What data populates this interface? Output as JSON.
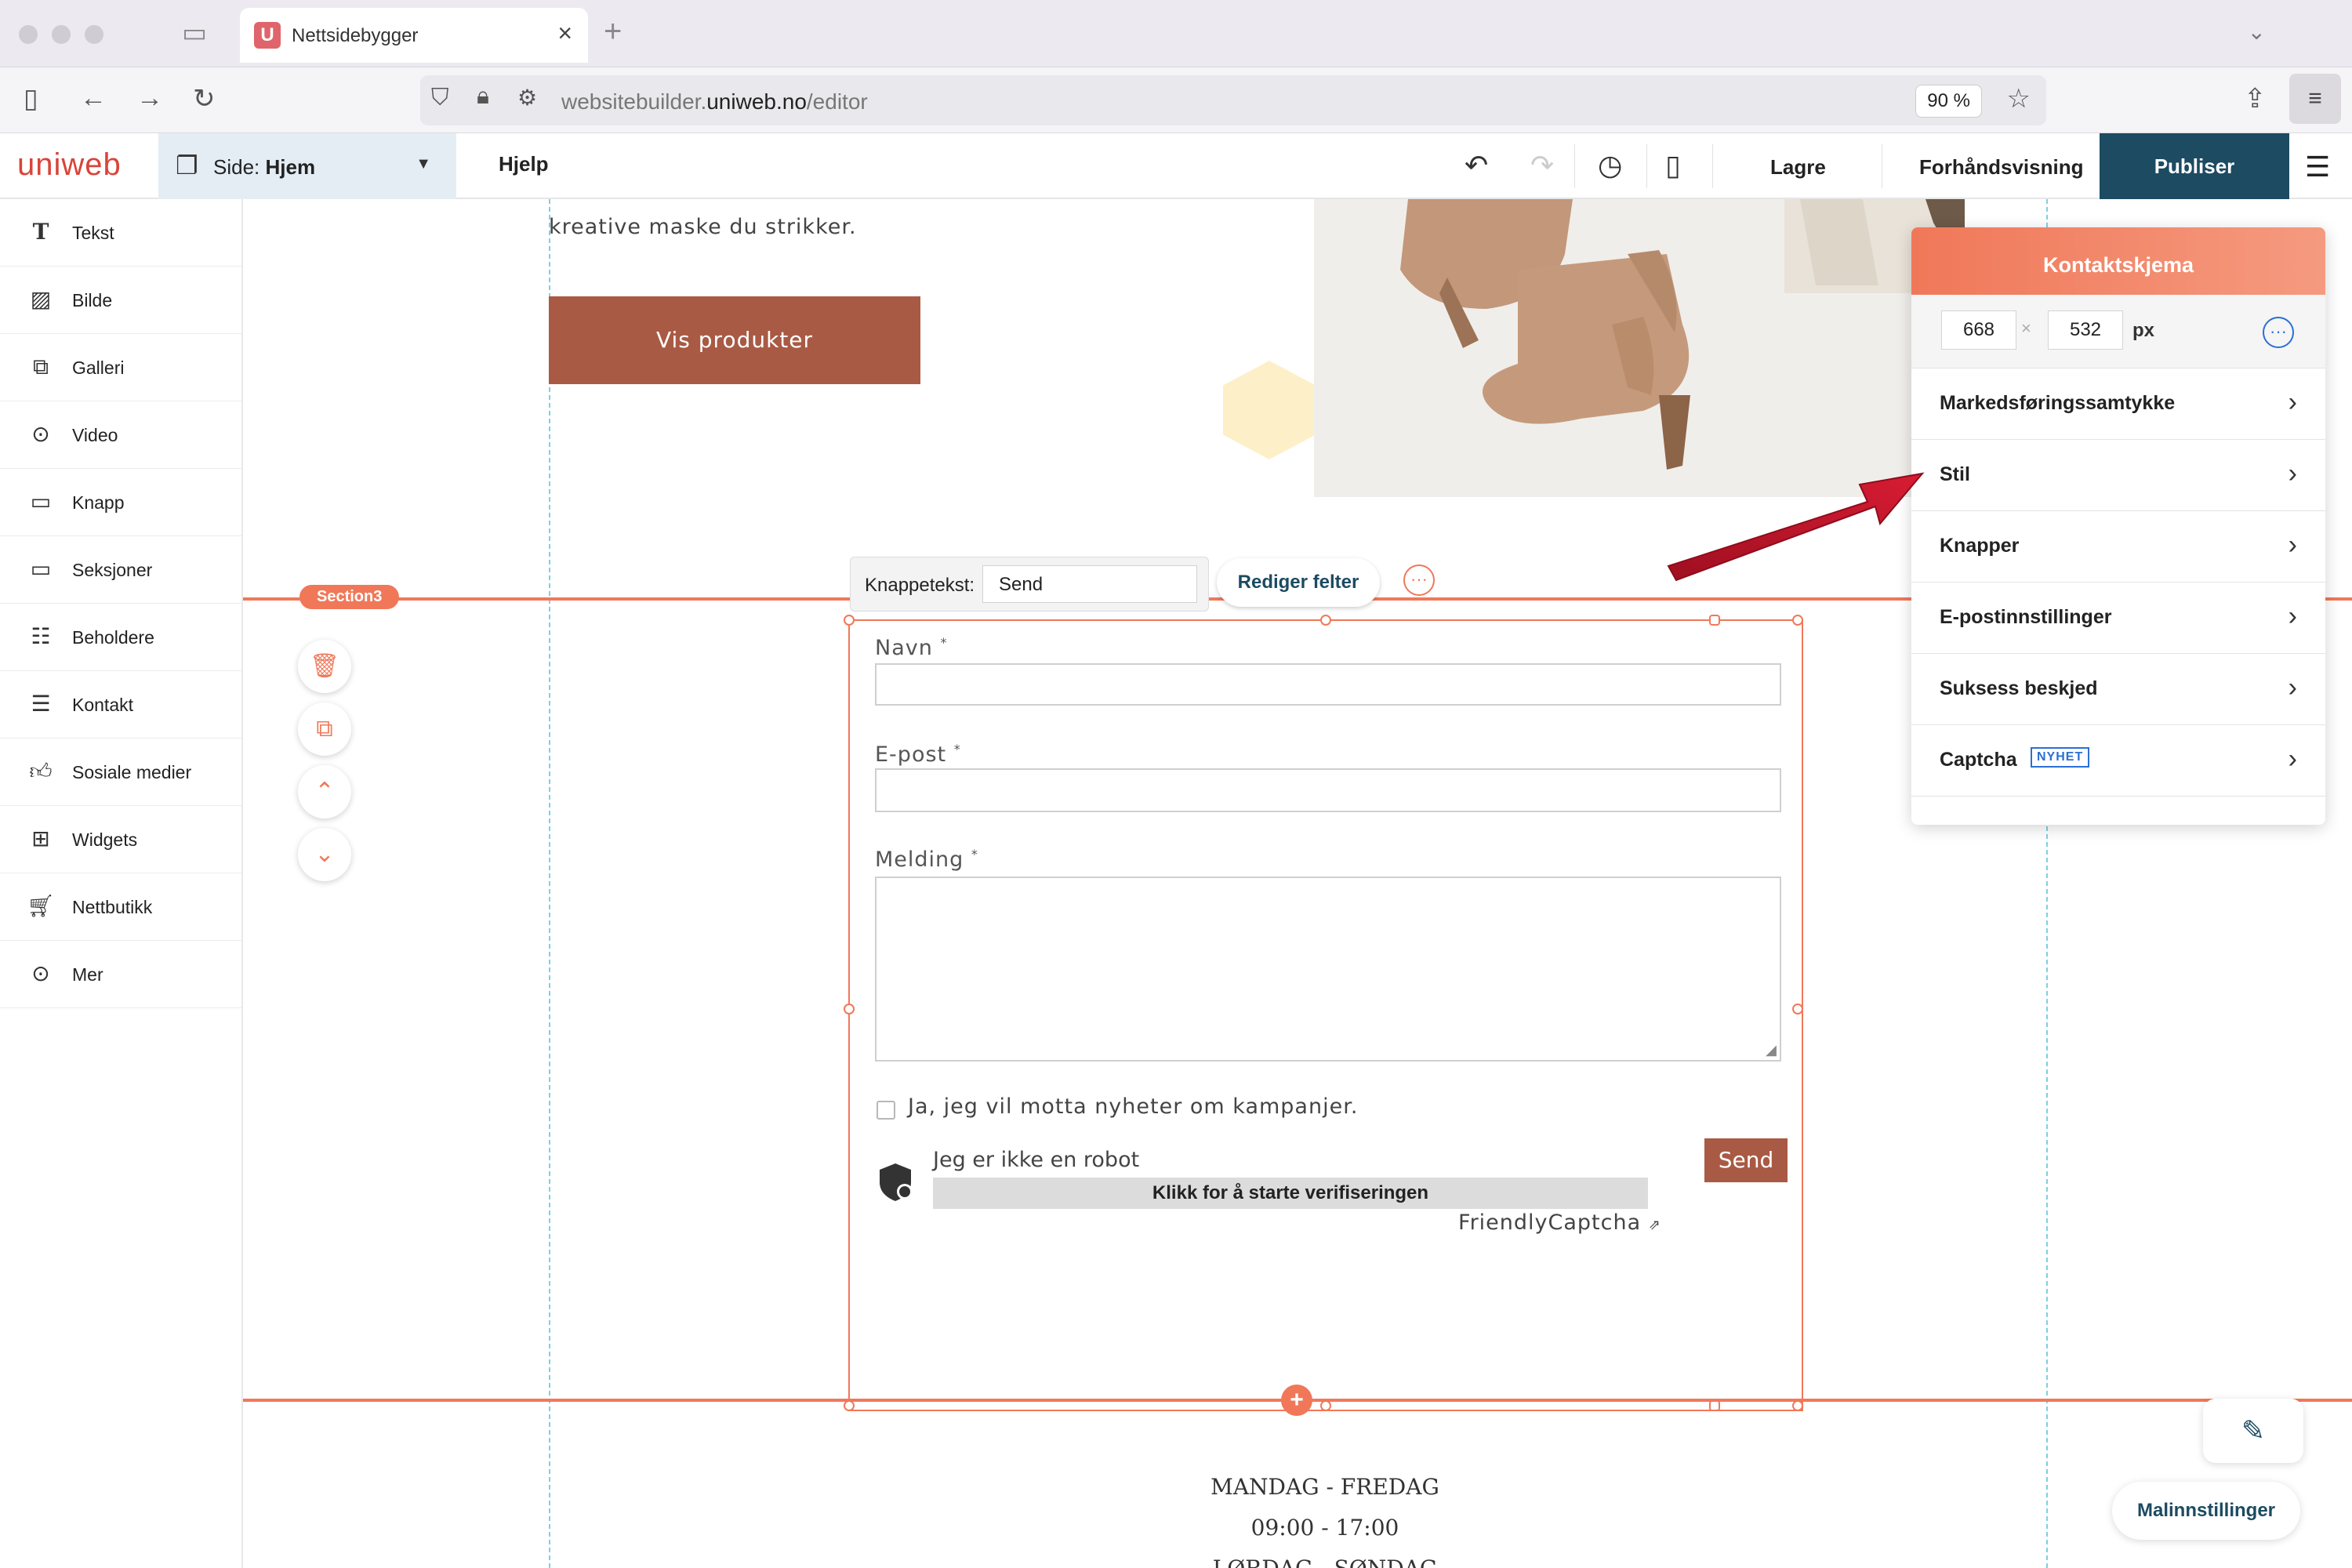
{
  "browser": {
    "tab_title": "Nettsidebygger",
    "tab_favicon": "U",
    "url_host": "websitebuilder.",
    "url_domain": "uniweb.no",
    "url_path": "/editor",
    "zoom": "90 %"
  },
  "app": {
    "logo": "uniweb",
    "page_label": "Side:",
    "page_name": "Hjem",
    "help": "Hjelp",
    "save": "Lagre",
    "preview": "Forhåndsvisning",
    "publish": "Publiser"
  },
  "sidebar": {
    "items": [
      {
        "label": "Tekst",
        "icon": "text-icon"
      },
      {
        "label": "Bilde",
        "icon": "image-icon"
      },
      {
        "label": "Galleri",
        "icon": "gallery-icon"
      },
      {
        "label": "Video",
        "icon": "video-icon"
      },
      {
        "label": "Knapp",
        "icon": "button-icon"
      },
      {
        "label": "Seksjoner",
        "icon": "sections-icon"
      },
      {
        "label": "Beholdere",
        "icon": "containers-icon"
      },
      {
        "label": "Kontakt",
        "icon": "contact-icon"
      },
      {
        "label": "Sosiale medier",
        "icon": "social-icon"
      },
      {
        "label": "Widgets",
        "icon": "widgets-icon"
      },
      {
        "label": "Nettbutikk",
        "icon": "cart-icon"
      },
      {
        "label": "Mer",
        "icon": "more-icon"
      }
    ]
  },
  "canvas": {
    "hero_text": "kreative maske du strikker.",
    "hero_button": "Vis produkter",
    "section_tag": "Section3",
    "button_text_label": "Knappetekst:",
    "button_text_value": "Send",
    "edit_fields": "Rediger felter",
    "form": {
      "name_label": "Navn",
      "email_label": "E-post",
      "message_label": "Melding",
      "required_mark": "*",
      "newsletter_label": "Ja, jeg vil motta nyheter om kampanjer.",
      "robot_text": "Jeg er ikke en robot",
      "verify_text": "Klikk for å starte verifiseringen",
      "captcha_brand": "FriendlyCaptcha",
      "send_button": "Send"
    },
    "hours": {
      "line1": "MANDAG - FREDAG",
      "line2": "09:00 - 17:00",
      "line3": "LØRDAG - SØNDAG"
    },
    "template_settings": "Malinnstillinger"
  },
  "panel": {
    "title": "Kontaktskjema",
    "width": "668",
    "height": "532",
    "unit": "px",
    "rows": [
      {
        "label": "Markedsføringssamtykke"
      },
      {
        "label": "Stil"
      },
      {
        "label": "Knapper"
      },
      {
        "label": "E-postinnstillinger"
      },
      {
        "label": "Suksess beskjed"
      },
      {
        "label": "Captcha",
        "badge": "NYHET"
      }
    ]
  },
  "colors": {
    "accent": "#f07859",
    "brand_dark": "#1c4b62",
    "button_brown": "#a95a44",
    "arrow_red": "#c0152a"
  }
}
